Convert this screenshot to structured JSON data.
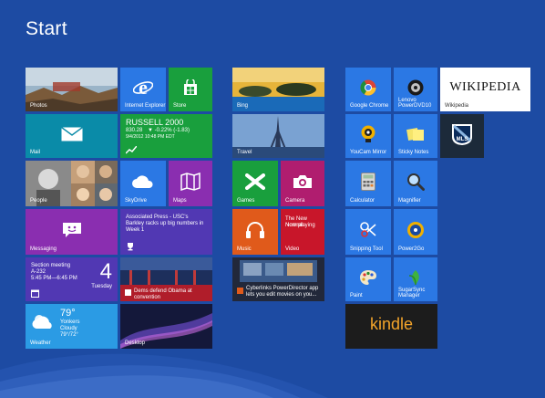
{
  "title": "Start",
  "group1": {
    "photos": {
      "label": "Photos"
    },
    "ie": {
      "label": "Internet Explorer"
    },
    "store": {
      "label": "Store"
    },
    "mail": {
      "label": "Mail"
    },
    "finance": {
      "label": "",
      "headline": "RUSSELL 2000",
      "value": "830.28",
      "change": "▼ -0.22% (-1.83)",
      "date": "9/4/2012 10:48 PM EDT"
    },
    "people": {
      "label": "People"
    },
    "skydrive": {
      "label": "SkyDrive"
    },
    "maps": {
      "label": "Maps"
    },
    "messaging": {
      "label": "Messaging"
    },
    "sports": {
      "label": "",
      "headline": "Associated Press - USC's Barkley racks up big numbers in Week 1"
    },
    "calendar": {
      "label": "",
      "event": "Section meeting",
      "room": "A-232",
      "time": "5:45 PM—6:45 PM",
      "day_number": "4",
      "day_name": "Tuesday"
    },
    "news": {
      "label": "",
      "headline": "Dems defend Obama at convention"
    },
    "weather": {
      "label": "Weather",
      "temp": "79°",
      "city": "Yonkers",
      "condition": "Cloudy",
      "range": "79°/72°"
    },
    "desktop": {
      "label": "Desktop"
    }
  },
  "group2": {
    "bing": {
      "label": "Bing"
    },
    "travel": {
      "label": "Travel"
    },
    "games": {
      "label": "Games"
    },
    "camera": {
      "label": "Camera"
    },
    "music": {
      "label": "Music"
    },
    "video": {
      "label": "Video",
      "headline": "The New Normal",
      "subline": "Now playing"
    },
    "cyberlink": {
      "label": "",
      "headline": "Cyberlinks PowerDirector app lets you edit movies on you..."
    }
  },
  "group3": {
    "chrome": {
      "label": "Google Chrome"
    },
    "powerdvd": {
      "label": "Lenovo PowerDVD10"
    },
    "wikipedia": {
      "label": "Wikipedia",
      "logo": "WIKIPEDIA"
    },
    "youcam": {
      "label": "YouCam Mirror"
    },
    "stickynotes": {
      "label": "Sticky Notes"
    },
    "mls": {
      "label": "MLS"
    },
    "calculator": {
      "label": "Calculator"
    },
    "magnifier": {
      "label": "Magnifier"
    },
    "snipping": {
      "label": "Snipping Tool"
    },
    "power2go": {
      "label": "Power2Go"
    },
    "paint": {
      "label": "Paint"
    },
    "supersync": {
      "label": "SugarSync Manager"
    },
    "kindle": {
      "label": "kindle"
    }
  },
  "colors": {
    "background": "#1d4ba3",
    "teal": "#0a8ba8",
    "blue": "#2b78e4",
    "green": "#199f3d",
    "purple": "#8a2eb0",
    "indigo": "#5138b3",
    "orange": "#e05a1b",
    "magenta": "#b01d6f",
    "dark": "#1c1c1c"
  }
}
